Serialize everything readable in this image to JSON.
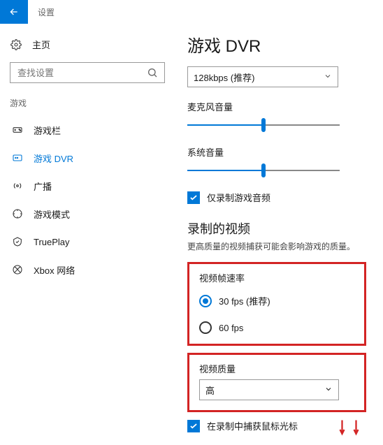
{
  "header": {
    "title": "设置"
  },
  "sidebar": {
    "home_label": "主页",
    "search_placeholder": "查找设置",
    "section_label": "游戏",
    "items": [
      {
        "label": "游戏栏"
      },
      {
        "label": "游戏 DVR"
      },
      {
        "label": "广播"
      },
      {
        "label": "游戏模式"
      },
      {
        "label": "TruePlay"
      },
      {
        "label": "Xbox 网络"
      }
    ]
  },
  "content": {
    "page_title": "游戏 DVR",
    "bitrate_value": "128kbps (推荐)",
    "mic_volume_label": "麦克风音量",
    "mic_volume_pct": 50,
    "sys_volume_label": "系统音量",
    "sys_volume_pct": 50,
    "audio_only_label": "仅录制游戏音频",
    "audio_only_checked": true,
    "rec_video_title": "录制的视频",
    "rec_video_desc": "更高质量的视频捕获可能会影响游戏的质量。",
    "fps_label": "视频帧速率",
    "fps_options": [
      {
        "label": "30 fps (推荐)",
        "checked": true
      },
      {
        "label": "60 fps",
        "checked": false
      }
    ],
    "quality_label": "视频质量",
    "quality_value": "高",
    "cursor_label": "在录制中捕获鼠标光标",
    "cursor_checked": true
  }
}
